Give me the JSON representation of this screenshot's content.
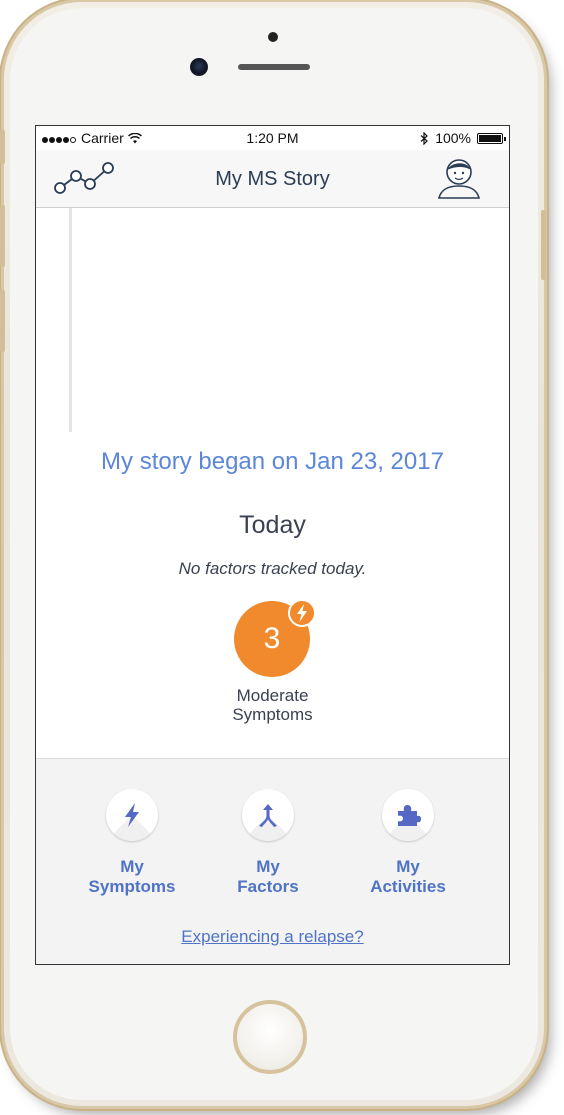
{
  "status_bar": {
    "carrier": "Carrier",
    "time": "1:20 PM",
    "battery_percent": "100%",
    "signal_bars": 4
  },
  "nav": {
    "title": "My MS Story",
    "left_icon": "timeline-graph-icon",
    "right_icon": "profile-avatar-icon"
  },
  "main": {
    "story_began": "My story began on Jan 23, 2017",
    "today_heading": "Today",
    "no_factors": "No factors tracked today.",
    "symptom_value": "3",
    "symptom_label_line1": "Moderate",
    "symptom_label_line2": "Symptoms"
  },
  "bottom": {
    "tiles": [
      {
        "line1": "My",
        "line2": "Symptoms",
        "icon": "lightning-icon"
      },
      {
        "line1": "My",
        "line2": "Factors",
        "icon": "merge-arrow-icon"
      },
      {
        "line1": "My",
        "line2": "Activities",
        "icon": "puzzle-icon"
      }
    ],
    "relapse_link": "Experiencing a relapse?"
  },
  "colors": {
    "accent_blue": "#5b86d9",
    "link_blue": "#4f73c7",
    "symptom_orange": "#f08a2c",
    "nav_title": "#2b3d55"
  }
}
